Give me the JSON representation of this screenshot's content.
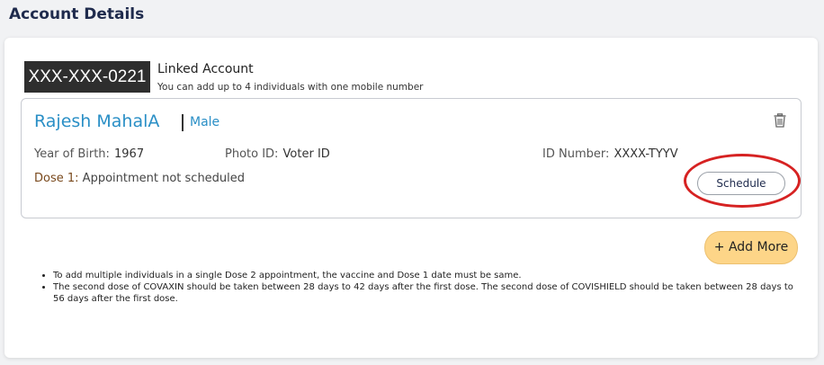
{
  "page": {
    "title": "Account Details"
  },
  "account": {
    "masked_mobile": "XXX-XXX-0221",
    "linked_title": "Linked Account",
    "linked_subtitle": "You can add up to 4 individuals with one mobile number"
  },
  "beneficiary": {
    "name": "Rajesh MahalA",
    "gender": "Male",
    "yob_label": "Year of Birth:",
    "yob_value": "1967",
    "photo_label": "Photo ID:",
    "photo_value": "Voter ID",
    "id_label": "ID Number:",
    "id_value": "XXXX-TYYV",
    "dose_label": "Dose 1:",
    "dose_status": "Appointment not scheduled",
    "schedule_label": "Schedule",
    "delete_icon": "trash-icon"
  },
  "actions": {
    "add_more_label": "+ Add More"
  },
  "notes": [
    "To add multiple individuals in a single Dose 2 appointment, the vaccine and Dose 1 date must be same.",
    "The second dose of COVAXIN should be taken between 28 days to 42 days after the first dose. The second dose of COVISHIELD should be taken between 28 days to 56 days after the first dose."
  ],
  "colors": {
    "accent_blue": "#2a8fc6",
    "add_more_bg": "#fdd588",
    "annotation_red": "#d62222",
    "badge_bg": "#2e2e2e"
  }
}
